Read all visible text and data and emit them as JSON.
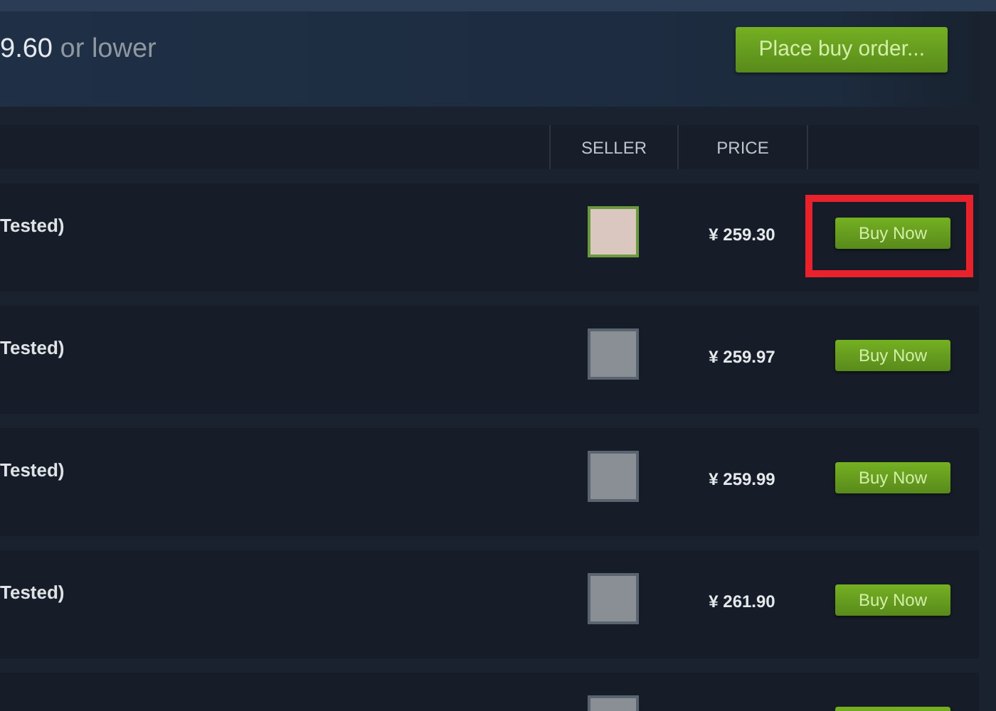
{
  "buy_order": {
    "price": "9.60",
    "suffix": "or lower",
    "button": "Place buy order..."
  },
  "table": {
    "columns": [
      "SELLER",
      "PRICE"
    ],
    "rows": [
      {
        "name": "Tested)",
        "price": "¥ 259.30",
        "button": "Buy Now",
        "highlighted": true
      },
      {
        "name": "Tested)",
        "price": "¥ 259.97",
        "button": "Buy Now",
        "highlighted": false
      },
      {
        "name": "Tested)",
        "price": "¥ 259.99",
        "button": "Buy Now",
        "highlighted": false
      },
      {
        "name": "Tested)",
        "price": "¥ 261.90",
        "button": "Buy Now",
        "highlighted": false
      }
    ],
    "partial_row": true
  }
}
